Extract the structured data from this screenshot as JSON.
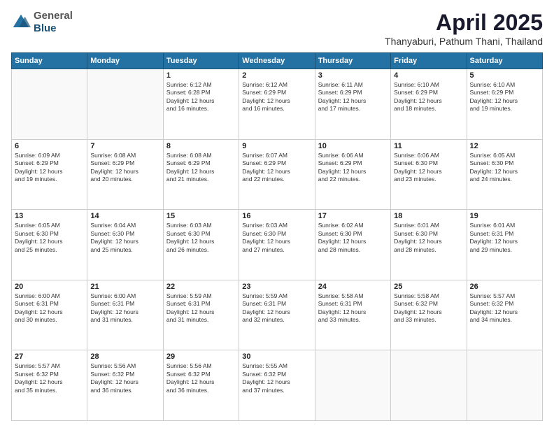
{
  "header": {
    "logo_general": "General",
    "logo_blue": "Blue",
    "month_title": "April 2025",
    "location": "Thanyaburi, Pathum Thani, Thailand"
  },
  "weekdays": [
    "Sunday",
    "Monday",
    "Tuesday",
    "Wednesday",
    "Thursday",
    "Friday",
    "Saturday"
  ],
  "rows": [
    [
      {
        "day": "",
        "lines": []
      },
      {
        "day": "",
        "lines": []
      },
      {
        "day": "1",
        "lines": [
          "Sunrise: 6:12 AM",
          "Sunset: 6:28 PM",
          "Daylight: 12 hours",
          "and 16 minutes."
        ]
      },
      {
        "day": "2",
        "lines": [
          "Sunrise: 6:12 AM",
          "Sunset: 6:29 PM",
          "Daylight: 12 hours",
          "and 16 minutes."
        ]
      },
      {
        "day": "3",
        "lines": [
          "Sunrise: 6:11 AM",
          "Sunset: 6:29 PM",
          "Daylight: 12 hours",
          "and 17 minutes."
        ]
      },
      {
        "day": "4",
        "lines": [
          "Sunrise: 6:10 AM",
          "Sunset: 6:29 PM",
          "Daylight: 12 hours",
          "and 18 minutes."
        ]
      },
      {
        "day": "5",
        "lines": [
          "Sunrise: 6:10 AM",
          "Sunset: 6:29 PM",
          "Daylight: 12 hours",
          "and 19 minutes."
        ]
      }
    ],
    [
      {
        "day": "6",
        "lines": [
          "Sunrise: 6:09 AM",
          "Sunset: 6:29 PM",
          "Daylight: 12 hours",
          "and 19 minutes."
        ]
      },
      {
        "day": "7",
        "lines": [
          "Sunrise: 6:08 AM",
          "Sunset: 6:29 PM",
          "Daylight: 12 hours",
          "and 20 minutes."
        ]
      },
      {
        "day": "8",
        "lines": [
          "Sunrise: 6:08 AM",
          "Sunset: 6:29 PM",
          "Daylight: 12 hours",
          "and 21 minutes."
        ]
      },
      {
        "day": "9",
        "lines": [
          "Sunrise: 6:07 AM",
          "Sunset: 6:29 PM",
          "Daylight: 12 hours",
          "and 22 minutes."
        ]
      },
      {
        "day": "10",
        "lines": [
          "Sunrise: 6:06 AM",
          "Sunset: 6:29 PM",
          "Daylight: 12 hours",
          "and 22 minutes."
        ]
      },
      {
        "day": "11",
        "lines": [
          "Sunrise: 6:06 AM",
          "Sunset: 6:30 PM",
          "Daylight: 12 hours",
          "and 23 minutes."
        ]
      },
      {
        "day": "12",
        "lines": [
          "Sunrise: 6:05 AM",
          "Sunset: 6:30 PM",
          "Daylight: 12 hours",
          "and 24 minutes."
        ]
      }
    ],
    [
      {
        "day": "13",
        "lines": [
          "Sunrise: 6:05 AM",
          "Sunset: 6:30 PM",
          "Daylight: 12 hours",
          "and 25 minutes."
        ]
      },
      {
        "day": "14",
        "lines": [
          "Sunrise: 6:04 AM",
          "Sunset: 6:30 PM",
          "Daylight: 12 hours",
          "and 25 minutes."
        ]
      },
      {
        "day": "15",
        "lines": [
          "Sunrise: 6:03 AM",
          "Sunset: 6:30 PM",
          "Daylight: 12 hours",
          "and 26 minutes."
        ]
      },
      {
        "day": "16",
        "lines": [
          "Sunrise: 6:03 AM",
          "Sunset: 6:30 PM",
          "Daylight: 12 hours",
          "and 27 minutes."
        ]
      },
      {
        "day": "17",
        "lines": [
          "Sunrise: 6:02 AM",
          "Sunset: 6:30 PM",
          "Daylight: 12 hours",
          "and 28 minutes."
        ]
      },
      {
        "day": "18",
        "lines": [
          "Sunrise: 6:01 AM",
          "Sunset: 6:30 PM",
          "Daylight: 12 hours",
          "and 28 minutes."
        ]
      },
      {
        "day": "19",
        "lines": [
          "Sunrise: 6:01 AM",
          "Sunset: 6:31 PM",
          "Daylight: 12 hours",
          "and 29 minutes."
        ]
      }
    ],
    [
      {
        "day": "20",
        "lines": [
          "Sunrise: 6:00 AM",
          "Sunset: 6:31 PM",
          "Daylight: 12 hours",
          "and 30 minutes."
        ]
      },
      {
        "day": "21",
        "lines": [
          "Sunrise: 6:00 AM",
          "Sunset: 6:31 PM",
          "Daylight: 12 hours",
          "and 31 minutes."
        ]
      },
      {
        "day": "22",
        "lines": [
          "Sunrise: 5:59 AM",
          "Sunset: 6:31 PM",
          "Daylight: 12 hours",
          "and 31 minutes."
        ]
      },
      {
        "day": "23",
        "lines": [
          "Sunrise: 5:59 AM",
          "Sunset: 6:31 PM",
          "Daylight: 12 hours",
          "and 32 minutes."
        ]
      },
      {
        "day": "24",
        "lines": [
          "Sunrise: 5:58 AM",
          "Sunset: 6:31 PM",
          "Daylight: 12 hours",
          "and 33 minutes."
        ]
      },
      {
        "day": "25",
        "lines": [
          "Sunrise: 5:58 AM",
          "Sunset: 6:32 PM",
          "Daylight: 12 hours",
          "and 33 minutes."
        ]
      },
      {
        "day": "26",
        "lines": [
          "Sunrise: 5:57 AM",
          "Sunset: 6:32 PM",
          "Daylight: 12 hours",
          "and 34 minutes."
        ]
      }
    ],
    [
      {
        "day": "27",
        "lines": [
          "Sunrise: 5:57 AM",
          "Sunset: 6:32 PM",
          "Daylight: 12 hours",
          "and 35 minutes."
        ]
      },
      {
        "day": "28",
        "lines": [
          "Sunrise: 5:56 AM",
          "Sunset: 6:32 PM",
          "Daylight: 12 hours",
          "and 36 minutes."
        ]
      },
      {
        "day": "29",
        "lines": [
          "Sunrise: 5:56 AM",
          "Sunset: 6:32 PM",
          "Daylight: 12 hours",
          "and 36 minutes."
        ]
      },
      {
        "day": "30",
        "lines": [
          "Sunrise: 5:55 AM",
          "Sunset: 6:32 PM",
          "Daylight: 12 hours",
          "and 37 minutes."
        ]
      },
      {
        "day": "",
        "lines": []
      },
      {
        "day": "",
        "lines": []
      },
      {
        "day": "",
        "lines": []
      }
    ]
  ]
}
